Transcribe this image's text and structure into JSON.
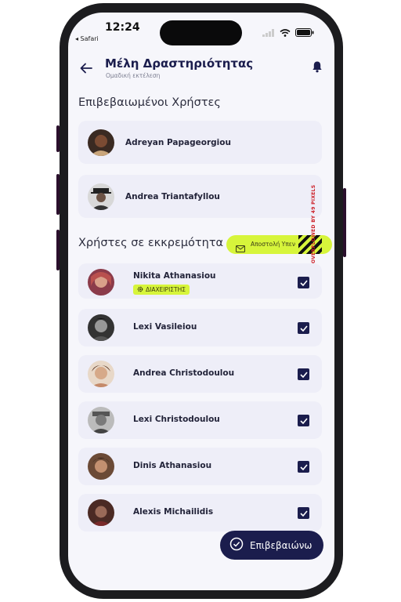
{
  "status_bar": {
    "time": "12:24",
    "back_label": "◂ Safari"
  },
  "header": {
    "title": "Μέλη Δραστηριότητας",
    "subtitle": "Ομαδική εκτέλεση"
  },
  "confirmed": {
    "title": "Επιβεβαιωμένοι Χρήστες",
    "users": [
      {
        "name": "Adreyan Papageorgiou",
        "avatar": "avatar-photo"
      },
      {
        "name": "Andrea Triantafyllou",
        "avatar": "avatar-photo"
      }
    ]
  },
  "pending": {
    "title": "Χρήστες σε εκκρεμότητα",
    "invite_button": "Αποστολή Υπεν",
    "admin_badge": "ΔΙΑΧΕΙΡΙΣΤΗΣ",
    "users": [
      {
        "name": "Nikita Athanasiou",
        "checked": true,
        "admin": true
      },
      {
        "name": "Lexi Vasileiou",
        "checked": true
      },
      {
        "name": "Andrea Christodoulou",
        "checked": true
      },
      {
        "name": "Lexi Christodoulou",
        "checked": true
      },
      {
        "name": "Dinis Athanasiou",
        "checked": true
      },
      {
        "name": "Alexis Michailidis",
        "checked": true
      }
    ]
  },
  "overflow_tag": "OVERFLOWED BY 49 PIXELS",
  "fab": {
    "label": "Επιβεβαιώνω"
  },
  "colors": {
    "primary": "#1b1d4d",
    "accent": "#d7f53b",
    "card": "#eeeef8",
    "background": "#f6f6fb"
  },
  "icons": [
    "back-arrow-icon",
    "bell-icon",
    "envelope-icon",
    "gear-icon",
    "checkbox-icon",
    "check-circle-icon",
    "wifi-icon",
    "battery-icon",
    "signal-icon"
  ]
}
